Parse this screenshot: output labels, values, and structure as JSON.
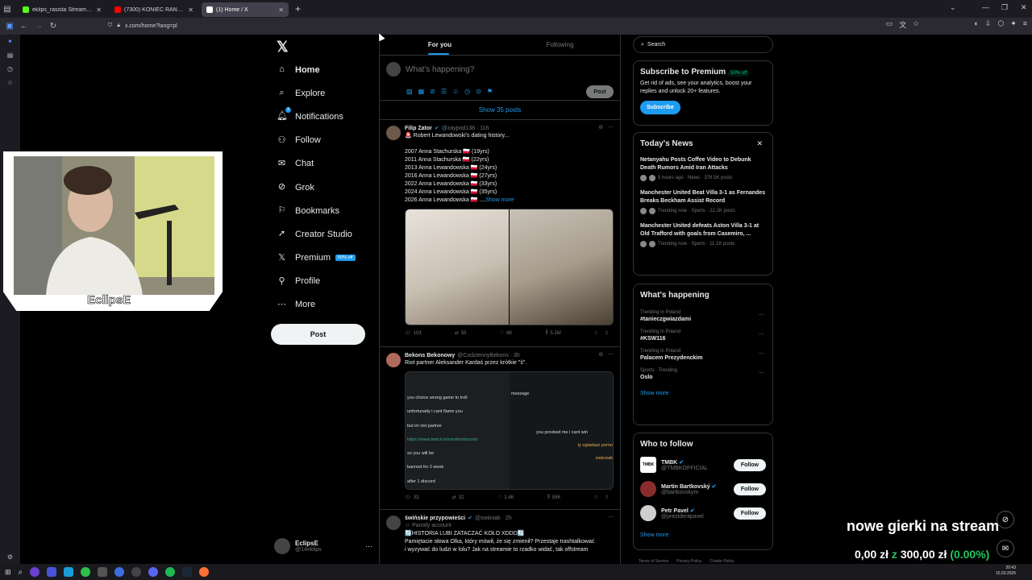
{
  "browser": {
    "tabs": [
      {
        "label": "eklips_rasista Stream - Kick Da",
        "color": "#53fc18"
      },
      {
        "label": "(7300) KONIEC RANDOMBRUC",
        "color": "#ff0000"
      },
      {
        "label": "(1) Home / X",
        "color": "#ffffff",
        "active": true
      }
    ],
    "url": "x.com/home?lang=pl"
  },
  "nav": {
    "items": [
      {
        "label": "Home",
        "icon": "home-icon"
      },
      {
        "label": "Explore",
        "icon": "search-icon"
      },
      {
        "label": "Notifications",
        "icon": "bell-icon",
        "badge": "1"
      },
      {
        "label": "Follow",
        "icon": "person-add-icon"
      },
      {
        "label": "Chat",
        "icon": "mail-icon"
      },
      {
        "label": "Grok",
        "icon": "grok-icon"
      },
      {
        "label": "Bookmarks",
        "icon": "bookmark-icon"
      },
      {
        "label": "Creator Studio",
        "icon": "rocket-icon"
      },
      {
        "label": "Premium",
        "icon": "x-logo-icon",
        "badge": "50% off"
      },
      {
        "label": "Profile",
        "icon": "person-icon"
      },
      {
        "label": "More",
        "icon": "more-icon"
      }
    ],
    "post_label": "Post",
    "account": {
      "name": "EclipsE",
      "handle": "@14eklips"
    }
  },
  "feed": {
    "tab_for_you": "For you",
    "tab_following": "Following",
    "composer_placeholder": "What's happening?",
    "composer_post": "Post",
    "show_posts": "Show 35 posts",
    "tweets": [
      {
        "name": "Filip Zator",
        "handle": "@zaypod138 · 11h",
        "text": "🚨 Robert Lewandowski's dating history...\n\n2007 Anna Stachurska 🇵🇱 (19yrs)\n2011 Anna Stachurska 🇵🇱 (22yrs)\n2013 Anna Lewandowska 🇵🇱 (24yrs)\n2016 Anna Lewandowska 🇵🇱 (27yrs)\n2022 Anna Lewandowska 🇵🇱 (33yrs)\n2024 Anna Lewandowska 🇵🇱 (35yrs)\n2026 Anna Lewandowska 🇵🇱 ....",
        "show_more": "Show more",
        "replies": "103",
        "reposts": "55",
        "likes": "8K",
        "views": "5.2M"
      },
      {
        "name": "Bekons Bekonowy",
        "handle": "@CodziennyBekons · 3h",
        "text": "Riot partner Aleksander Kardaś przez krótkie \"ś\".",
        "replies": "33",
        "reposts": "32",
        "likes": "1.4K",
        "views": "58K",
        "screenshot_lines": [
          "you choice wrong game to troll",
          "unfortunatly i cant flame you",
          "but im riot partner",
          "https://www.twitch.tv/randombrucetv",
          "so you will be",
          "banned for 2 week",
          "after 1 discord"
        ],
        "screenshot_right": [
          "message",
          "you provbed me i cant win",
          "ty ogladasz porno",
          "zwierzak"
        ]
      },
      {
        "name": "świńskie przypowieści",
        "handle": "@swiiniak · 2h",
        "parody": "Parody account",
        "text": "🔄HISTORIA LUBI ZATACZAĆ KOŁO XDDD🔄\nPamiętacie słowa Olka, który mówił, że się zmienił? Przestaje trashtalkować\ni wyzywać do ludzi w lolu? Jak na streamie to rzadko widać, tak offstream"
      }
    ]
  },
  "right": {
    "search_placeholder": "Search",
    "premium": {
      "title": "Subscribe to Premium",
      "badge": "50% off",
      "desc": "Get rid of ads, see your analytics, boost your replies and unlock 20+ features.",
      "button": "Subscribe"
    },
    "news": {
      "title": "Today's News",
      "items": [
        {
          "title": "Netanyahu Posts Coffee Video to Debunk Death Rumors Amid Iran Attacks",
          "meta": "5 hours ago · News · 376.5K posts"
        },
        {
          "title": "Manchester United Beat Villa 3-1 as Fernandes Breaks Beckham Assist Record",
          "meta": "Trending now · Sports · 22.2K posts"
        },
        {
          "title": "Manchester United defeats Aston Villa 3-1 at Old Trafford with goals from Casemiro, ...",
          "meta": "Trending now · Sports · 11.1K posts"
        }
      ]
    },
    "happening": {
      "title": "What's happening",
      "trends": [
        {
          "cat": "Trending in Poland",
          "name": "#tanieczgwiazdami"
        },
        {
          "cat": "Trending in Poland",
          "name": "#KSW116"
        },
        {
          "cat": "Trending in Poland",
          "name": "Palacem Prezydenckim"
        },
        {
          "cat": "Sports · Trending",
          "name": "Oslo"
        }
      ],
      "show_more": "Show more"
    },
    "who": {
      "title": "Who to follow",
      "people": [
        {
          "name": "TMBK",
          "handle": "@TMBKOFFICIAL"
        },
        {
          "name": "Martin Bartkovský",
          "handle": "@bartkovskym"
        },
        {
          "name": "Petr Pavel",
          "handle": "@prezidentpavel"
        }
      ],
      "follow": "Follow",
      "show_more": "Show more"
    },
    "footer": [
      "Terms of Service",
      "Privacy Policy",
      "Cookie Policy"
    ]
  },
  "stream": {
    "webcam_label": "EclipsE",
    "overlay_title": "nowe gierki na stream",
    "goal_current": "0,00 zł",
    "goal_sep": "z",
    "goal_target": "300,00 zł",
    "goal_pct": "(0.00%)"
  },
  "taskbar": {
    "time": "20:43",
    "date": "15.03.2026"
  }
}
